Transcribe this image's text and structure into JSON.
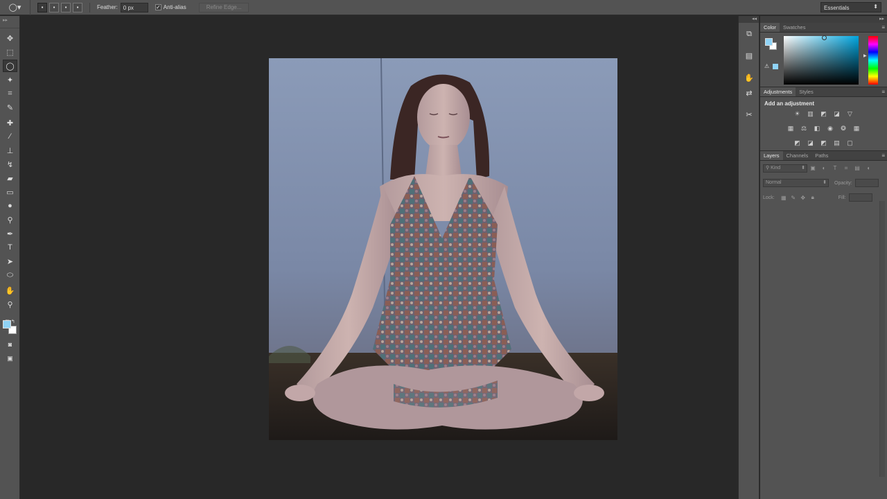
{
  "options_bar": {
    "tool_preset_icon": "lasso-icon",
    "selection_modes": [
      "new-selection-icon",
      "add-to-selection-icon",
      "subtract-from-selection-icon",
      "intersect-selection-icon"
    ],
    "feather_label": "Feather:",
    "feather_value": "0 px",
    "antialias_label": "Anti-alias",
    "antialias_checked": true,
    "refine_edge_label": "Refine Edge...",
    "workspace": "Essentials"
  },
  "tools": [
    {
      "name": "move-tool",
      "glyph": "✥"
    },
    {
      "name": "rectangular-marquee-tool",
      "glyph": "⬚"
    },
    {
      "name": "lasso-tool",
      "glyph": "◯",
      "active": true
    },
    {
      "name": "quick-selection-tool",
      "glyph": "✦"
    },
    {
      "name": "crop-tool",
      "glyph": "⌗"
    },
    {
      "name": "eyedropper-tool",
      "glyph": "✎"
    },
    {
      "name": "spot-healing-brush-tool",
      "glyph": "✚"
    },
    {
      "name": "brush-tool",
      "glyph": "∕"
    },
    {
      "name": "clone-stamp-tool",
      "glyph": "⊥"
    },
    {
      "name": "history-brush-tool",
      "glyph": "↯"
    },
    {
      "name": "eraser-tool",
      "glyph": "▰"
    },
    {
      "name": "gradient-tool",
      "glyph": "▭"
    },
    {
      "name": "blur-tool",
      "glyph": "●"
    },
    {
      "name": "dodge-tool",
      "glyph": "⚲"
    },
    {
      "name": "pen-tool",
      "glyph": "✒"
    },
    {
      "name": "type-tool",
      "glyph": "T"
    },
    {
      "name": "path-selection-tool",
      "glyph": "➤"
    },
    {
      "name": "ellipse-tool",
      "glyph": "⬭"
    },
    {
      "name": "hand-tool",
      "glyph": "✋"
    },
    {
      "name": "zoom-tool",
      "glyph": "⚲"
    }
  ],
  "foreground_color": "#8fd3f6",
  "background_color": "#ffffff",
  "panel_strip_icons": [
    "history-icon",
    "actions-icon",
    "brush-presets-icon",
    "tool-presets-icon",
    "clone-source-icon"
  ],
  "color_panel": {
    "tabs": [
      "Color",
      "Swatches"
    ],
    "active_tab": "Color"
  },
  "adjustments_panel": {
    "tabs": [
      "Adjustments",
      "Styles"
    ],
    "title": "Add an adjustment",
    "rows": [
      [
        "brightness-contrast-icon",
        "levels-icon",
        "curves-icon",
        "exposure-icon",
        "vibrance-icon"
      ],
      [
        "hue-saturation-icon",
        "color-balance-icon",
        "black-white-icon",
        "photo-filter-icon",
        "channel-mixer-icon",
        "color-lookup-icon"
      ],
      [
        "invert-icon",
        "posterize-icon",
        "threshold-icon",
        "gradient-map-icon",
        "selective-color-icon"
      ]
    ]
  },
  "layers_panel": {
    "tabs": [
      "Layers",
      "Channels",
      "Paths"
    ],
    "kind_label": "Kind",
    "blend_mode": "Normal",
    "opacity_label": "Opacity:",
    "lock_label": "Lock:",
    "fill_label": "Fill:"
  }
}
